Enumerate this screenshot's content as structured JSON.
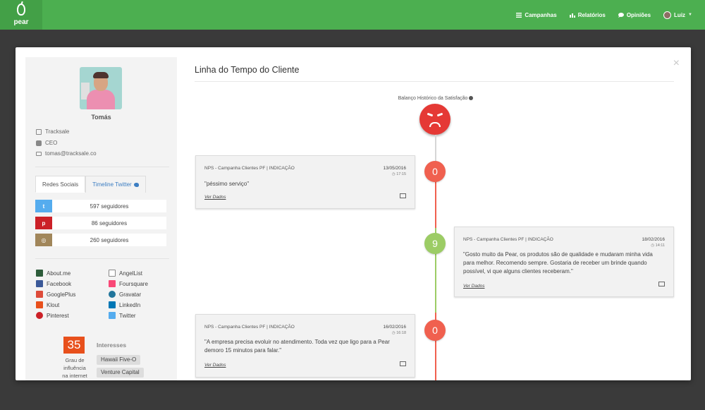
{
  "brand": {
    "name": "pear"
  },
  "nav": {
    "items": [
      {
        "label": "Campanhas",
        "icon": "list-icon"
      },
      {
        "label": "Relatórios",
        "icon": "bar-chart-icon"
      },
      {
        "label": "Opiniões",
        "icon": "comment-icon"
      }
    ],
    "user": "Luiz"
  },
  "profile": {
    "name": "Tomás",
    "company": "Tracksale",
    "role": "CEO",
    "email": "tomas@tracksale.co",
    "tabs": [
      "Redes Sociais",
      "Timeline Twitter"
    ],
    "social_counts": [
      {
        "network": "twitter",
        "count": "597 seguidores",
        "color": "#55acee"
      },
      {
        "network": "pinterest",
        "count": "86 seguidores",
        "color": "#cb2027"
      },
      {
        "network": "instagram",
        "count": "260 seguidores",
        "color": "#a1865a"
      }
    ],
    "links": [
      {
        "label": "About.me",
        "color": "#2d5c3a"
      },
      {
        "label": "AngelList",
        "color": "#888888"
      },
      {
        "label": "Facebook",
        "color": "#3b5998"
      },
      {
        "label": "Foursquare",
        "color": "#f94877"
      },
      {
        "label": "GooglePlus",
        "color": "#dd4b39"
      },
      {
        "label": "Gravatar",
        "color": "#21759b"
      },
      {
        "label": "Klout",
        "color": "#e8501c"
      },
      {
        "label": "LinkedIn",
        "color": "#0077b5"
      },
      {
        "label": "Pinterest",
        "color": "#cb2027"
      },
      {
        "label": "Twitter",
        "color": "#55acee"
      }
    ],
    "klout_score": "35",
    "klout_label_1": "Grau de",
    "klout_label_2": "influência",
    "klout_label_3": "na internet",
    "interests_title": "Interesses",
    "interests": [
      "Hawaii Five-O",
      "Venture Capital"
    ]
  },
  "timeline": {
    "title": "Linha do Tempo do Cliente",
    "balance_label": "Balanço Histórico da Satisfação",
    "entries": [
      {
        "campaign": "NPS - Campanha Clientes PF | INDICAÇÃO",
        "date": "13/05/2016",
        "time": "17:15",
        "score": "0",
        "quote": "\"péssimo serviço\"",
        "link": "Ver Dados",
        "side": "left",
        "color": "#f0604f"
      },
      {
        "campaign": "NPS - Campanha Clientes PF | INDICAÇÃO",
        "date": "18/02/2016",
        "time": "14:11",
        "score": "9",
        "quote_1": "\"Gosto muito da Pear, os produtos são de qualidade e mudaram minha vida",
        "quote_2": "para melhor. Recomendo sempre. Gostaria de receber um brinde quando",
        "quote_3": "possível, vi que alguns clientes receberam.\"",
        "link": "Ver Dados",
        "side": "right",
        "color": "#9ccc65"
      },
      {
        "campaign": "NPS - Campanha Clientes PF | INDICAÇÃO",
        "date": "16/02/2016",
        "time": "16:18",
        "score": "0",
        "quote_1": "\"A empresa precisa evoluir no atendimento. Toda vez que ligo para a Pear",
        "quote_2": "demoro 15 minutos para falar.\"",
        "link": "Ver Dados",
        "side": "left",
        "color": "#f0604f"
      }
    ]
  },
  "colors": {
    "topbar": "#4caf50",
    "detractor": "#f0604f",
    "promoter": "#9ccc65",
    "face": "#e53935"
  }
}
